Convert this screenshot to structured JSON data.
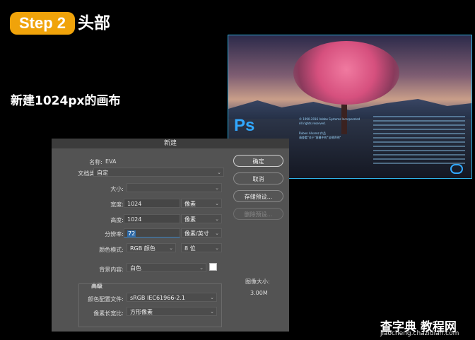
{
  "header": {
    "step_label": "Step 2",
    "title": "头部"
  },
  "subtitle": "新建1024px的画布",
  "splash": {
    "logo": "Ps",
    "copyright_lines": [
      "© 1990-2016 Adobe Systems Incorporated",
      "All rights reserved."
    ],
    "artist_lines": [
      "Ruben Alvarez 作品",
      "请查看\"关于\"屏幕中的\"法律声明\""
    ]
  },
  "dialog": {
    "title": "新建",
    "name_label": "名称:",
    "name_value": "EVA",
    "doctype_label": "文档类型:",
    "doctype_value": "自定",
    "size_label": "大小:",
    "width_label": "宽度:",
    "width_value": "1024",
    "width_unit": "像素",
    "height_label": "高度:",
    "height_value": "1024",
    "height_unit": "像素",
    "resolution_label": "分辨率:",
    "resolution_value": "72",
    "resolution_unit": "像素/英寸",
    "colormode_label": "颜色模式:",
    "colormode_value": "RGB 颜色",
    "bitdepth_value": "8 位",
    "background_label": "背景内容:",
    "background_value": "白色",
    "advanced_label": "高级",
    "profile_label": "颜色配置文件:",
    "profile_value": "sRGB IEC61966-2.1",
    "aspect_label": "像素长宽比:",
    "aspect_value": "方形像素",
    "ok_label": "确定",
    "cancel_label": "取消",
    "save_preset_label": "存储预设...",
    "delete_preset_label": "删除预设...",
    "image_size_label": "图像大小:",
    "image_size_value": "3.00M"
  },
  "watermark": {
    "title": "查字典 教程网",
    "url": "jiaocheng.chazidian.com"
  },
  "colors": {
    "accent": "#f0a30a",
    "splash_border": "#2fb2e6",
    "ps_blue": "#31a8ff"
  }
}
